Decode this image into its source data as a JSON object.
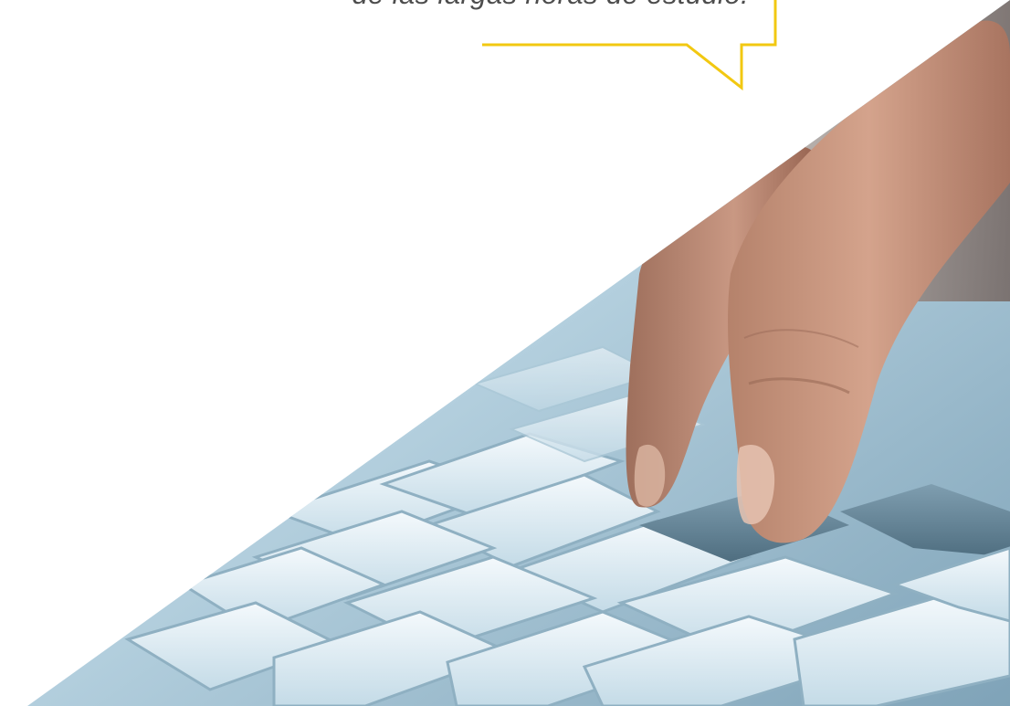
{
  "quote": {
    "text": "de las largas horas de estudio."
  },
  "colors": {
    "accent": "#f2c811",
    "text": "#4d4d4d",
    "background": "#ffffff"
  },
  "images": {
    "photo": "hand-typing-on-keyboard"
  }
}
